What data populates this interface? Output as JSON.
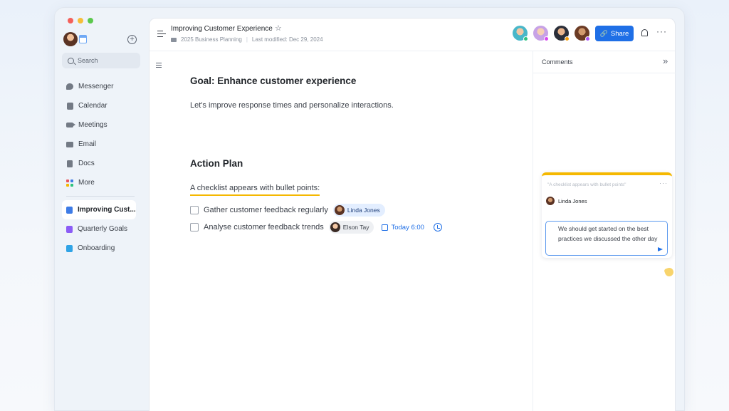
{
  "sidebar": {
    "search_placeholder": "Search",
    "nav": [
      {
        "label": "Messenger",
        "icon": "chat-bubble-icon"
      },
      {
        "label": "Calendar",
        "icon": "calendar-icon"
      },
      {
        "label": "Meetings",
        "icon": "video-camera-icon"
      },
      {
        "label": "Email",
        "icon": "envelope-icon"
      },
      {
        "label": "Docs",
        "icon": "document-icon"
      },
      {
        "label": "More",
        "icon": "grid-apps-icon"
      }
    ],
    "pages": [
      {
        "label": "Improving Cust...",
        "color": "#3d7be6"
      },
      {
        "label": "Quarterly Goals",
        "color": "#8b5cf6"
      },
      {
        "label": "Onboarding",
        "color": "#2fa3e6"
      }
    ]
  },
  "header": {
    "title": "Improving Customer Experience",
    "folder": "2025 Business Planning",
    "modified": "Last modified: Dec 29, 2024",
    "share_label": "Share",
    "presence_dots": [
      "#2ec27e",
      "#d946ef",
      "#f59e0b",
      "#a855f7"
    ]
  },
  "doc": {
    "goal_title": "Goal: Enhance customer experience",
    "goal_text": "Let's improve response times and personalize interactions.",
    "plan_title": "Action Plan",
    "highlight_text": "A checklist appears with bullet points:",
    "tasks": [
      {
        "text": "Gather customer feedback regularly",
        "assignee": "Linda Jones"
      },
      {
        "text": "Analyse customer feedback trends",
        "assignee": "Elson Tay",
        "due": "Today 6:00"
      }
    ]
  },
  "comments": {
    "title": "Comments",
    "quote": "\"A checklist appears with bullet points\"",
    "user": "Linda Jones",
    "draft": "We should get started on the best practices we discussed the other day"
  },
  "colors": {
    "accent": "#1f6fe6",
    "highlight": "#f5b800"
  }
}
